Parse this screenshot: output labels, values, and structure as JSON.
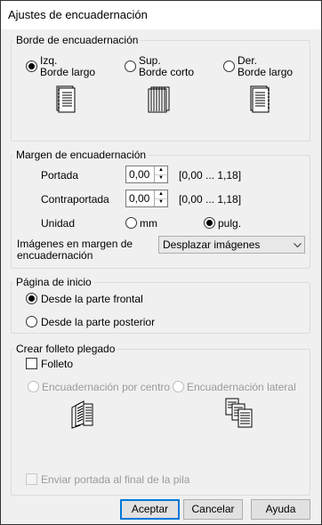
{
  "window": {
    "title": "Ajustes de encuadernación"
  },
  "binding_edge": {
    "legend": "Borde de encuadernación",
    "options": [
      {
        "line1": "Izq.",
        "line2": "Borde largo",
        "checked": true,
        "icon": "left-bound-page-icon"
      },
      {
        "line1": "Sup.",
        "line2": "Borde corto",
        "checked": false,
        "icon": "top-bound-page-icon"
      },
      {
        "line1": "Der.",
        "line2": "Borde largo",
        "checked": false,
        "icon": "right-bound-page-icon"
      }
    ]
  },
  "binding_margin": {
    "legend": "Margen de encuadernación",
    "front_label": "Portada",
    "front_value": "0,00",
    "front_range": "[0,00 ... 1,18]",
    "back_label": "Contraportada",
    "back_value": "0,00",
    "back_range": "[0,00 ... 1,18]",
    "unit_label": "Unidad",
    "unit_mm": "mm",
    "unit_inch": "pulg.",
    "unit_selected": "pulg.",
    "images_label_line1": "Imágenes en margen de",
    "images_label_line2": "encuadernación",
    "images_value": "Desplazar imágenes"
  },
  "start_page": {
    "legend": "Página de inicio",
    "front": "Desde la parte frontal",
    "back": "Desde la parte posterior",
    "selected": "front"
  },
  "booklet": {
    "legend": "Crear folleto plegado",
    "checkbox_label": "Folleto",
    "checked": false,
    "center_label": "Encuadernación por centro",
    "side_label": "Encuadernación lateral",
    "send_cover_label": "Enviar portada al final de la pila"
  },
  "buttons": {
    "ok": "Aceptar",
    "cancel": "Cancelar",
    "help": "Ayuda"
  }
}
